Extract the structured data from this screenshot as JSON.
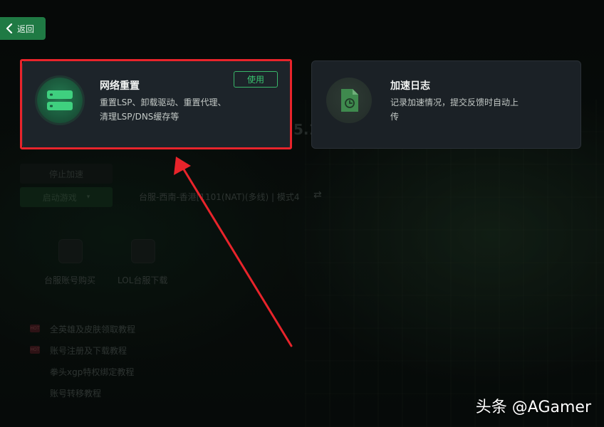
{
  "back": {
    "label": "返回"
  },
  "cards": [
    {
      "title": "网络重置",
      "desc_line1": "重置LSP、卸载驱动、重置代理、",
      "desc_line2": "清理LSP/DNS缓存等",
      "button_label": "使用"
    },
    {
      "title": "加速日志",
      "desc_line1": "记录加速情况，提交反馈时自动上",
      "desc_line2": "传"
    }
  ],
  "background": {
    "stop_label": "停止加速",
    "start_game_label": "启动游戏",
    "server_info": "台服-西南-香港[1101(NAT)(多线) | 模式4",
    "version_fragment": "5.1",
    "tools": [
      "台服账号购买",
      "LOL台服下载"
    ],
    "tutorials": [
      "全英雄及皮肤领取教程",
      "账号注册及下载教程",
      "拳头xgp特权绑定教程",
      "账号转移教程"
    ],
    "hot_badge": "HOT"
  },
  "watermark": "头条 @AGamer",
  "colors": {
    "accent_green": "#39c36f",
    "back_bg": "#1f7a44",
    "annotation_red": "#e8242b"
  }
}
